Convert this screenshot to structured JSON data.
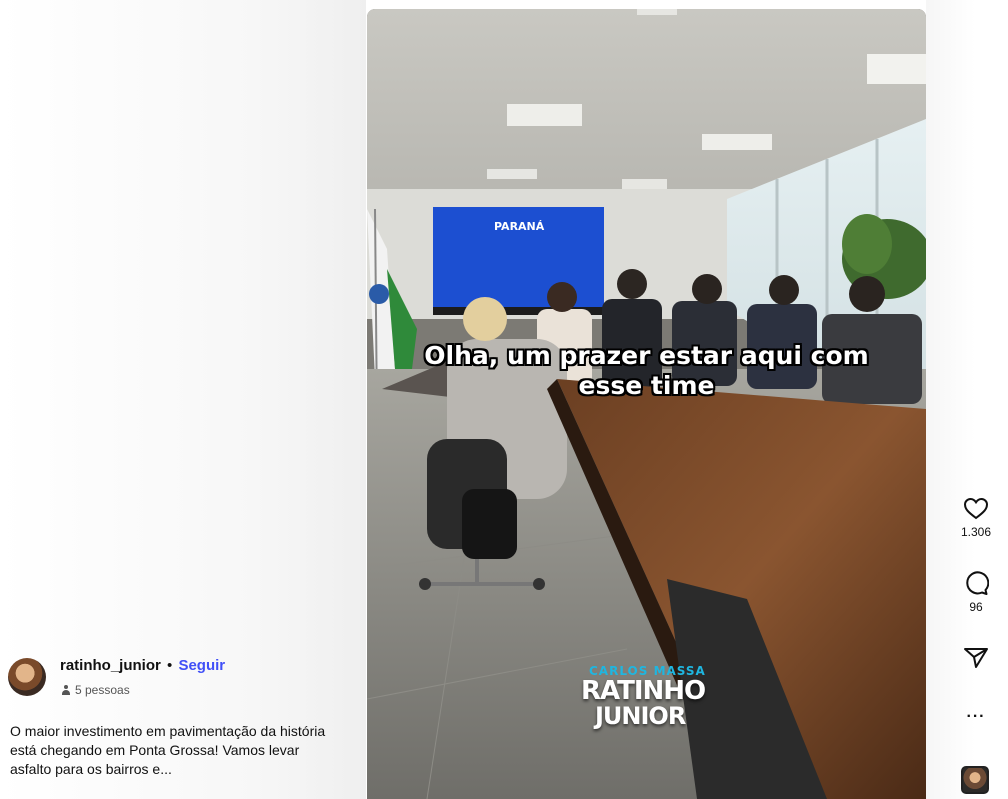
{
  "post": {
    "author": "ratinho_junior",
    "separator": "•",
    "follow_label": "Seguir",
    "audience": "5 pessoas",
    "description": "O maior investimento em pavimentação da história está chegando em Ponta Grossa! Vamos levar asfalto para os bairros e..."
  },
  "video": {
    "caption_line1": "Olha, um prazer estar aqui com",
    "caption_line2": "esse time",
    "screen_logo": "PARANÁ",
    "logo_top": "CARLOS  MASSA",
    "logo_mid": "RATINHO",
    "logo_bottom": "JUNIOR"
  },
  "actions": {
    "likes": "1.306",
    "comments": "96",
    "more": "···"
  },
  "icons": [
    "heart-icon",
    "comment-icon",
    "share-icon",
    "more-icon"
  ]
}
